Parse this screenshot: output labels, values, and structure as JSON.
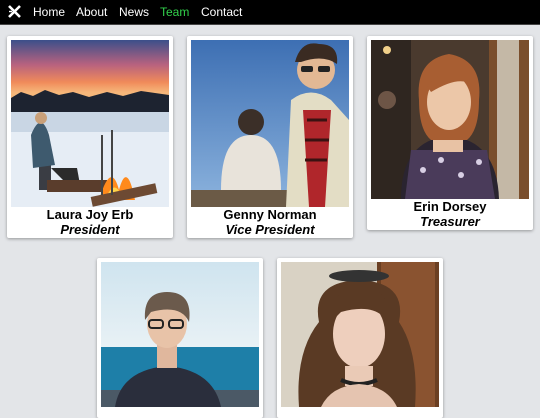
{
  "nav": {
    "logo_icon": "x-logo-icon",
    "items": [
      {
        "label": "Home",
        "active": false
      },
      {
        "label": "About",
        "active": false
      },
      {
        "label": "News",
        "active": false
      },
      {
        "label": "Team",
        "active": true
      },
      {
        "label": "Contact",
        "active": false
      }
    ],
    "active_color": "#32d14b"
  },
  "team": [
    {
      "name": "Laura Joy Erb",
      "role": "President"
    },
    {
      "name": "Genny Norman",
      "role": "Vice President"
    },
    {
      "name": "Erin Dorsey",
      "role": "Treasurer"
    },
    {
      "name": "",
      "role": ""
    },
    {
      "name": "",
      "role": ""
    }
  ]
}
